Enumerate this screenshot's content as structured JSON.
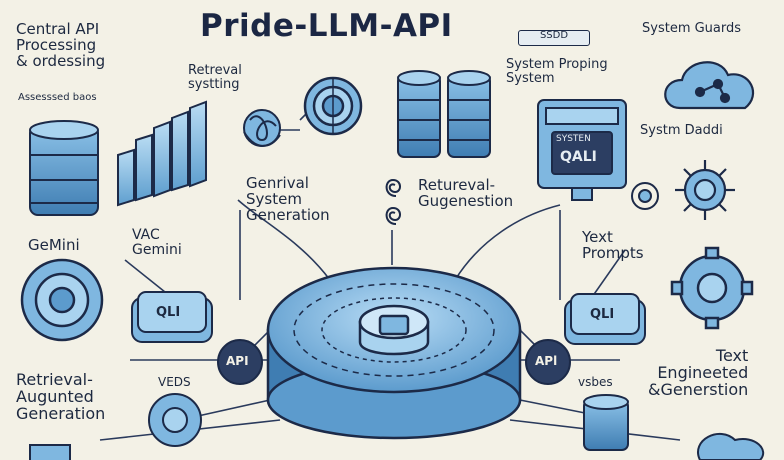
{
  "title": "Pride-LLM-API",
  "colors": {
    "background": "#f3f1e6",
    "primary_blue": "#7fb7e0",
    "light_blue": "#a9d3ef",
    "dark_outline": "#1c2a48",
    "text": "#1d2940"
  },
  "labels": {
    "central_api": "Central API\nProcessing\n& ordessing",
    "central_api_sub": "Assesssed baos",
    "retrieval_sys": "Retreval\nsystting",
    "top_center_box": "SSDD",
    "system_prompting": "System Proping\nSystem",
    "system_guards": "System Guards",
    "system_daddi": "Systm Daddi",
    "screen_text_1": "SYSTEN",
    "screen_text_2": "QALI",
    "gemini_left": "GeMini",
    "vac_gemini": "VAC\nGemini",
    "genrival": "Genrival\nSystem\nGeneration",
    "retrieval_gug": "Retureval-\nGugenestion",
    "yext_prompts": "Yext\nPrompts",
    "api_left": "API",
    "api_right": "APl",
    "vbds_left": "VEDS",
    "vbds_right": "vsbes",
    "rag_bottom": "Retrieval-\nAugunted\nGeneration",
    "text_eng": "Text\nEngineeted\n&Generstion",
    "chip_left": "QLI",
    "chip_right": "QLI"
  },
  "icons": [
    "database-stack-icon",
    "server-racks-icon",
    "knot-brain-icon",
    "target-circle-icon",
    "disk-stack-icon",
    "monitor-window-icon",
    "cloud-network-icon",
    "cog-hub-icon",
    "spiral-icon",
    "gear-icon",
    "central-platform-icon"
  ]
}
